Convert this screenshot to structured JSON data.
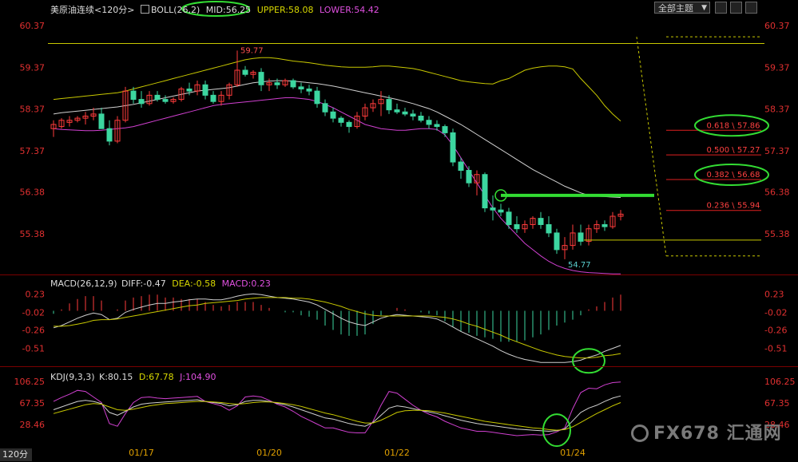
{
  "header": {
    "symbol": "美原油连续",
    "period_tag": "<120分>",
    "boll_label": "BOLL(26,2)",
    "mid": "MID:56.25",
    "upper": "UPPER:58.08",
    "lower": "LOWER:54.42",
    "theme_select": "全部主题",
    "theme_arrow": "▼"
  },
  "macd_header": {
    "label": "MACD(26,12,9)",
    "diff": "DIFF:-0.47",
    "dea": "DEA:-0.58",
    "macd": "MACD:0.23"
  },
  "kdj_header": {
    "label": "KDJ(9,3,3)",
    "k": "K:80.15",
    "d": "D:67.78",
    "j": "J:104.90"
  },
  "period_button": "120分",
  "watermark": "FX678 汇通网",
  "colors": {
    "up": "#ff3b3b",
    "down": "#3cd6a0",
    "mid": "#d0d0d0",
    "upper": "#c8c800",
    "lower": "#d040d0",
    "green_line": "#33dd33"
  },
  "chart_data": [
    {
      "type": "candlestick",
      "y_ticks": [
        "60.37",
        "59.37",
        "58.37",
        "57.37",
        "56.38",
        "55.38"
      ],
      "ylim": [
        54.5,
        60.6
      ],
      "x_ticks": [
        "01/17",
        "01/20",
        "01/22",
        "01/24"
      ],
      "annotations": {
        "high": "59.77",
        "low": "54.77"
      },
      "candles": [
        {
          "o": 57.9,
          "h": 58.1,
          "l": 57.7,
          "c": 58.0
        },
        {
          "o": 57.95,
          "h": 58.15,
          "l": 57.9,
          "c": 58.1
        },
        {
          "o": 58.05,
          "h": 58.2,
          "l": 57.95,
          "c": 58.1
        },
        {
          "o": 58.1,
          "h": 58.2,
          "l": 58.05,
          "c": 58.15
        },
        {
          "o": 58.15,
          "h": 58.3,
          "l": 58.0,
          "c": 58.2
        },
        {
          "o": 58.2,
          "h": 58.4,
          "l": 58.1,
          "c": 58.25
        },
        {
          "o": 58.25,
          "h": 58.4,
          "l": 58.0,
          "c": 57.9
        },
        {
          "o": 57.9,
          "h": 58.1,
          "l": 57.5,
          "c": 57.6
        },
        {
          "o": 57.6,
          "h": 58.2,
          "l": 57.55,
          "c": 58.1
        },
        {
          "o": 58.1,
          "h": 58.9,
          "l": 58.05,
          "c": 58.8
        },
        {
          "o": 58.8,
          "h": 58.9,
          "l": 58.5,
          "c": 58.6
        },
        {
          "o": 58.6,
          "h": 58.8,
          "l": 58.4,
          "c": 58.5
        },
        {
          "o": 58.5,
          "h": 58.8,
          "l": 58.45,
          "c": 58.7
        },
        {
          "o": 58.7,
          "h": 58.8,
          "l": 58.55,
          "c": 58.6
        },
        {
          "o": 58.6,
          "h": 58.7,
          "l": 58.5,
          "c": 58.55
        },
        {
          "o": 58.55,
          "h": 58.65,
          "l": 58.5,
          "c": 58.6
        },
        {
          "o": 58.6,
          "h": 58.9,
          "l": 58.55,
          "c": 58.85
        },
        {
          "o": 58.85,
          "h": 59.0,
          "l": 58.7,
          "c": 58.8
        },
        {
          "o": 58.8,
          "h": 59.05,
          "l": 58.7,
          "c": 58.95
        },
        {
          "o": 58.95,
          "h": 59.05,
          "l": 58.6,
          "c": 58.7
        },
        {
          "o": 58.7,
          "h": 58.8,
          "l": 58.5,
          "c": 58.55
        },
        {
          "o": 58.55,
          "h": 58.8,
          "l": 58.45,
          "c": 58.7
        },
        {
          "o": 58.7,
          "h": 59.0,
          "l": 58.6,
          "c": 58.95
        },
        {
          "o": 58.95,
          "h": 59.77,
          "l": 58.9,
          "c": 59.3
        },
        {
          "o": 59.3,
          "h": 59.4,
          "l": 59.15,
          "c": 59.2
        },
        {
          "o": 59.2,
          "h": 59.3,
          "l": 59.1,
          "c": 59.25
        },
        {
          "o": 59.25,
          "h": 59.35,
          "l": 58.8,
          "c": 58.95
        },
        {
          "o": 58.95,
          "h": 59.1,
          "l": 58.8,
          "c": 59.0
        },
        {
          "o": 59.0,
          "h": 59.1,
          "l": 58.85,
          "c": 58.95
        },
        {
          "o": 58.95,
          "h": 59.1,
          "l": 58.9,
          "c": 59.05
        },
        {
          "o": 59.05,
          "h": 59.1,
          "l": 58.85,
          "c": 58.9
        },
        {
          "o": 58.9,
          "h": 59.0,
          "l": 58.75,
          "c": 58.85
        },
        {
          "o": 58.85,
          "h": 58.95,
          "l": 58.7,
          "c": 58.8
        },
        {
          "o": 58.8,
          "h": 58.9,
          "l": 58.4,
          "c": 58.5
        },
        {
          "o": 58.5,
          "h": 58.6,
          "l": 58.2,
          "c": 58.3
        },
        {
          "o": 58.3,
          "h": 58.4,
          "l": 58.05,
          "c": 58.15
        },
        {
          "o": 58.15,
          "h": 58.2,
          "l": 57.95,
          "c": 58.05
        },
        {
          "o": 58.05,
          "h": 58.1,
          "l": 57.8,
          "c": 57.95
        },
        {
          "o": 57.95,
          "h": 58.3,
          "l": 57.9,
          "c": 58.2
        },
        {
          "o": 58.2,
          "h": 58.5,
          "l": 58.1,
          "c": 58.4
        },
        {
          "o": 58.4,
          "h": 58.6,
          "l": 58.3,
          "c": 58.5
        },
        {
          "o": 58.5,
          "h": 58.8,
          "l": 58.2,
          "c": 58.6
        },
        {
          "o": 58.6,
          "h": 58.7,
          "l": 58.25,
          "c": 58.35
        },
        {
          "o": 58.35,
          "h": 58.5,
          "l": 58.25,
          "c": 58.3
        },
        {
          "o": 58.3,
          "h": 58.4,
          "l": 58.2,
          "c": 58.25
        },
        {
          "o": 58.25,
          "h": 58.35,
          "l": 58.1,
          "c": 58.2
        },
        {
          "o": 58.2,
          "h": 58.3,
          "l": 58.05,
          "c": 58.1
        },
        {
          "o": 58.1,
          "h": 58.2,
          "l": 57.9,
          "c": 58.0
        },
        {
          "o": 58.0,
          "h": 58.1,
          "l": 57.85,
          "c": 57.95
        },
        {
          "o": 57.95,
          "h": 58.0,
          "l": 57.7,
          "c": 57.8
        },
        {
          "o": 57.8,
          "h": 57.9,
          "l": 57.0,
          "c": 57.1
        },
        {
          "o": 57.1,
          "h": 57.2,
          "l": 56.7,
          "c": 56.9
        },
        {
          "o": 56.9,
          "h": 57.0,
          "l": 56.5,
          "c": 56.6
        },
        {
          "o": 56.6,
          "h": 56.9,
          "l": 56.3,
          "c": 56.8
        },
        {
          "o": 56.8,
          "h": 56.85,
          "l": 55.9,
          "c": 56.0
        },
        {
          "o": 56.0,
          "h": 56.3,
          "l": 55.7,
          "c": 55.95
        },
        {
          "o": 55.95,
          "h": 56.1,
          "l": 55.8,
          "c": 55.9
        },
        {
          "o": 55.9,
          "h": 56.0,
          "l": 55.5,
          "c": 55.6
        },
        {
          "o": 55.6,
          "h": 55.8,
          "l": 55.4,
          "c": 55.5
        },
        {
          "o": 55.5,
          "h": 55.7,
          "l": 55.4,
          "c": 55.6
        },
        {
          "o": 55.6,
          "h": 55.8,
          "l": 55.5,
          "c": 55.75
        },
        {
          "o": 55.75,
          "h": 55.9,
          "l": 55.5,
          "c": 55.6
        },
        {
          "o": 55.6,
          "h": 55.8,
          "l": 55.3,
          "c": 55.4
        },
        {
          "o": 55.4,
          "h": 55.5,
          "l": 54.9,
          "c": 55.0
        },
        {
          "o": 55.0,
          "h": 55.3,
          "l": 54.77,
          "c": 55.1
        },
        {
          "o": 55.1,
          "h": 55.6,
          "l": 55.0,
          "c": 55.4
        },
        {
          "o": 55.4,
          "h": 55.6,
          "l": 55.1,
          "c": 55.2
        },
        {
          "o": 55.2,
          "h": 55.6,
          "l": 55.1,
          "c": 55.5
        },
        {
          "o": 55.5,
          "h": 55.7,
          "l": 55.4,
          "c": 55.6
        },
        {
          "o": 55.6,
          "h": 55.7,
          "l": 55.45,
          "c": 55.55
        },
        {
          "o": 55.55,
          "h": 55.9,
          "l": 55.5,
          "c": 55.8
        },
        {
          "o": 55.8,
          "h": 55.95,
          "l": 55.7,
          "c": 55.85
        }
      ],
      "mid": [
        58.25,
        58.28,
        58.3,
        58.32,
        58.34,
        58.36,
        58.38,
        58.4,
        58.42,
        58.45,
        58.48,
        58.52,
        58.56,
        58.6,
        58.64,
        58.68,
        58.72,
        58.76,
        58.8,
        58.82,
        58.84,
        58.86,
        58.88,
        58.92,
        58.96,
        59.0,
        59.02,
        59.04,
        59.05,
        59.05,
        59.04,
        59.02,
        59.0,
        58.98,
        58.95,
        58.92,
        58.88,
        58.84,
        58.8,
        58.76,
        58.72,
        58.68,
        58.64,
        58.6,
        58.55,
        58.5,
        58.44,
        58.38,
        58.3,
        58.2,
        58.1,
        58.0,
        57.88,
        57.76,
        57.64,
        57.52,
        57.4,
        57.28,
        57.16,
        57.04,
        56.92,
        56.82,
        56.72,
        56.62,
        56.52,
        56.44,
        56.36,
        56.3,
        56.28,
        56.27,
        56.26,
        56.25
      ],
      "upper": [
        58.6,
        58.62,
        58.64,
        58.66,
        58.68,
        58.7,
        58.72,
        58.74,
        58.76,
        58.8,
        58.85,
        58.9,
        58.95,
        59.0,
        59.05,
        59.1,
        59.15,
        59.2,
        59.25,
        59.3,
        59.35,
        59.4,
        59.45,
        59.5,
        59.55,
        59.58,
        59.6,
        59.6,
        59.58,
        59.55,
        59.52,
        59.5,
        59.48,
        59.45,
        59.42,
        59.4,
        59.38,
        59.37,
        59.37,
        59.37,
        59.38,
        59.4,
        59.4,
        59.38,
        59.36,
        59.34,
        59.3,
        59.25,
        59.2,
        59.15,
        59.1,
        59.05,
        59.02,
        59.0,
        58.98,
        58.97,
        59.05,
        59.1,
        59.2,
        59.3,
        59.35,
        59.38,
        59.4,
        59.4,
        59.38,
        59.33,
        59.1,
        58.9,
        58.7,
        58.45,
        58.25,
        58.08
      ],
      "lower": [
        57.9,
        57.88,
        57.87,
        57.86,
        57.85,
        57.85,
        57.86,
        57.88,
        57.9,
        57.92,
        57.95,
        58.0,
        58.05,
        58.1,
        58.15,
        58.2,
        58.25,
        58.3,
        58.35,
        58.4,
        58.45,
        58.48,
        58.5,
        58.52,
        58.54,
        58.56,
        58.58,
        58.6,
        58.62,
        58.64,
        58.64,
        58.62,
        58.6,
        58.55,
        58.48,
        58.4,
        58.3,
        58.2,
        58.1,
        58.0,
        57.95,
        57.9,
        57.88,
        57.86,
        57.86,
        57.88,
        57.9,
        57.9,
        57.88,
        57.75,
        57.5,
        57.2,
        56.9,
        56.6,
        56.3,
        56.0,
        55.75,
        55.55,
        55.35,
        55.15,
        55.0,
        54.85,
        54.72,
        54.62,
        54.55,
        54.5,
        54.47,
        54.45,
        54.44,
        54.43,
        54.42,
        54.42
      ],
      "support_line": {
        "y": 56.3
      },
      "low_line": {
        "y": 55.23
      },
      "top_line": {
        "y": 59.94
      },
      "fib_levels": [
        {
          "label": "0.618 \\ 57.86",
          "y": 57.86,
          "circled": true
        },
        {
          "label": "0.500 \\ 57.27",
          "y": 57.27,
          "circled": false
        },
        {
          "label": "0.382 \\ 56.68",
          "y": 56.68,
          "circled": true
        },
        {
          "label": "0.236 \\ 55.94",
          "y": 55.94,
          "circled": false
        }
      ],
      "fib_top": 60.1,
      "fib_bottom": 54.85
    },
    {
      "type": "macd",
      "y_ticks": [
        "0.23",
        "-0.02",
        "-0.26",
        "-0.51"
      ],
      "ylim": [
        -0.72,
        0.32
      ],
      "diff": [
        -0.23,
        -0.2,
        -0.15,
        -0.1,
        -0.06,
        -0.03,
        -0.05,
        -0.12,
        -0.1,
        -0.02,
        0.02,
        0.05,
        0.08,
        0.1,
        0.1,
        0.12,
        0.13,
        0.15,
        0.16,
        0.16,
        0.15,
        0.15,
        0.17,
        0.2,
        0.22,
        0.23,
        0.22,
        0.2,
        0.18,
        0.17,
        0.16,
        0.14,
        0.12,
        0.08,
        0.02,
        -0.04,
        -0.1,
        -0.15,
        -0.18,
        -0.2,
        -0.15,
        -0.1,
        -0.07,
        -0.05,
        -0.06,
        -0.07,
        -0.08,
        -0.09,
        -0.11,
        -0.16,
        -0.22,
        -0.28,
        -0.33,
        -0.38,
        -0.43,
        -0.48,
        -0.54,
        -0.59,
        -0.63,
        -0.66,
        -0.68,
        -0.7,
        -0.7,
        -0.7,
        -0.7,
        -0.69,
        -0.67,
        -0.63,
        -0.6,
        -0.55,
        -0.51,
        -0.47
      ],
      "dea": [
        -0.21,
        -0.21,
        -0.2,
        -0.18,
        -0.16,
        -0.13,
        -0.12,
        -0.12,
        -0.11,
        -0.09,
        -0.07,
        -0.05,
        -0.03,
        -0.01,
        0.01,
        0.03,
        0.05,
        0.07,
        0.08,
        0.1,
        0.11,
        0.12,
        0.13,
        0.14,
        0.16,
        0.17,
        0.18,
        0.18,
        0.18,
        0.18,
        0.17,
        0.17,
        0.16,
        0.14,
        0.12,
        0.09,
        0.06,
        0.02,
        -0.01,
        -0.04,
        -0.06,
        -0.07,
        -0.07,
        -0.07,
        -0.07,
        -0.07,
        -0.07,
        -0.07,
        -0.08,
        -0.09,
        -0.11,
        -0.14,
        -0.18,
        -0.21,
        -0.25,
        -0.29,
        -0.33,
        -0.38,
        -0.42,
        -0.46,
        -0.5,
        -0.54,
        -0.57,
        -0.6,
        -0.62,
        -0.63,
        -0.64,
        -0.64,
        -0.63,
        -0.61,
        -0.6,
        -0.58
      ]
    },
    {
      "type": "kdj",
      "y_ticks": [
        "106.25",
        "67.35",
        "28.46"
      ],
      "ylim": [
        -5,
        112
      ],
      "k": [
        55,
        60,
        65,
        70,
        72,
        70,
        66,
        50,
        45,
        52,
        60,
        65,
        67,
        68,
        69,
        70,
        71,
        72,
        73,
        70,
        68,
        66,
        62,
        64,
        70,
        72,
        72,
        70,
        67,
        64,
        60,
        55,
        50,
        45,
        40,
        38,
        34,
        30,
        27,
        25,
        32,
        45,
        58,
        62,
        60,
        57,
        54,
        51,
        48,
        44,
        40,
        36,
        33,
        30,
        28,
        26,
        24,
        22,
        20,
        19,
        18,
        17,
        16,
        17,
        20,
        35,
        50,
        58,
        63,
        70,
        76,
        80
      ],
      "d": [
        48,
        52,
        56,
        60,
        64,
        66,
        65,
        60,
        55,
        54,
        56,
        59,
        62,
        64,
        66,
        67,
        68,
        69,
        70,
        70,
        69,
        68,
        66,
        65,
        66,
        68,
        69,
        69,
        68,
        66,
        64,
        61,
        57,
        53,
        49,
        46,
        42,
        38,
        34,
        31,
        31,
        36,
        43,
        50,
        53,
        54,
        54,
        53,
        51,
        49,
        46,
        43,
        40,
        37,
        34,
        32,
        30,
        28,
        26,
        24,
        22,
        21,
        19,
        18,
        19,
        24,
        32,
        40,
        48,
        55,
        62,
        68
      ],
      "j": [
        70,
        77,
        83,
        90,
        88,
        78,
        68,
        30,
        25,
        48,
        68,
        77,
        78,
        76,
        75,
        76,
        77,
        78,
        79,
        70,
        66,
        62,
        54,
        62,
        78,
        80,
        78,
        72,
        65,
        60,
        52,
        43,
        36,
        29,
        22,
        22,
        18,
        14,
        13,
        13,
        34,
        63,
        88,
        85,
        74,
        63,
        54,
        47,
        42,
        34,
        28,
        22,
        19,
        16,
        16,
        14,
        12,
        10,
        8,
        9,
        10,
        9,
        10,
        15,
        22,
        57,
        86,
        94,
        93,
        100,
        104,
        105
      ]
    }
  ]
}
